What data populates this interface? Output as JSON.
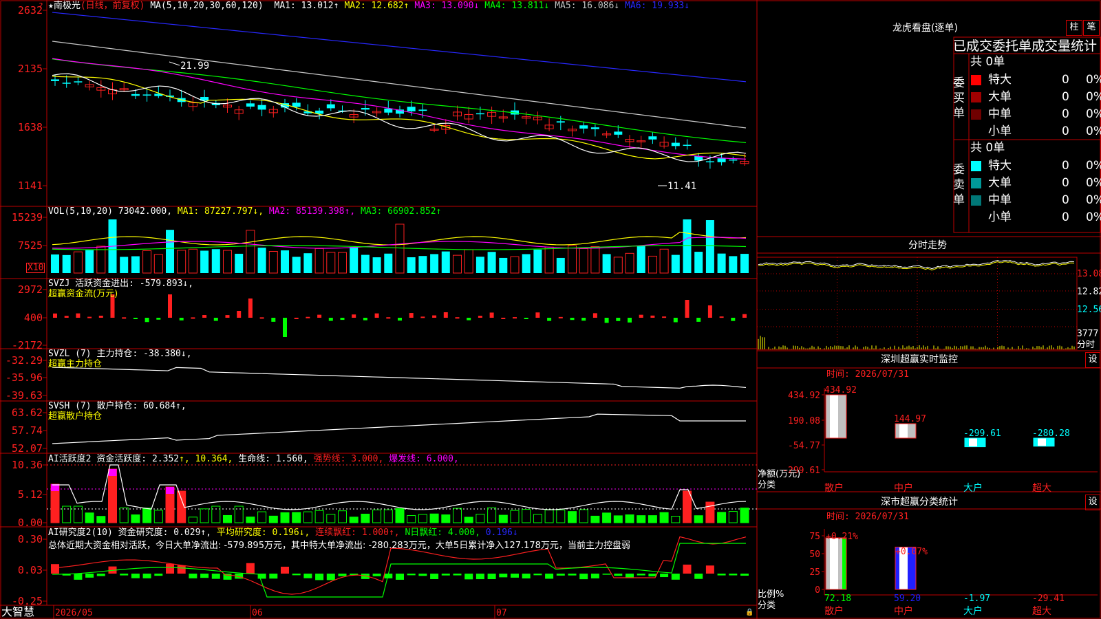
{
  "colors": {
    "up": "#ff2020",
    "down": "#00ffff",
    "grid": "#c00000",
    "yellow": "#ffff00",
    "magenta": "#ff00ff",
    "green": "#00ff00",
    "white": "#ffffff",
    "blue": "#2828ff",
    "gray": "#c0c0c0"
  },
  "main": {
    "title_star": "★",
    "stock_name": "南极光",
    "period": "(日线，前复权)",
    "ma_label": "MA(5,10,20,30,60,120)",
    "ma_values": [
      {
        "label": "MA1: 13.012",
        "arrow": "↑",
        "color": "#ffffff"
      },
      {
        "label": "MA2: 12.682",
        "arrow": "↑",
        "color": "#ffff00"
      },
      {
        "label": "MA3: 13.090",
        "arrow": "↓",
        "color": "#ff00ff"
      },
      {
        "label": "MA4: 13.811",
        "arrow": "↓",
        "color": "#00ff00"
      },
      {
        "label": "MA5: 16.086",
        "arrow": "↓",
        "color": "#c0c0c0"
      },
      {
        "label": "MA6: 19.933",
        "arrow": "↓",
        "color": "#2828ff"
      }
    ],
    "y_ticks": [
      "2632",
      "2135",
      "1638",
      "1141"
    ],
    "high_mark": "21.99",
    "low_mark": "11.41",
    "corner_mark": "?"
  },
  "volume": {
    "label": "VOL(5,10,20)",
    "value": "73042.000",
    "ma1": "MA1: 87227.797↓",
    "ma2": "MA2: 85139.398↑",
    "ma3": "MA3: 66902.852↑",
    "y_ticks": [
      "15239",
      "7525"
    ],
    "unit": "X10"
  },
  "svzj": {
    "label": "SVZJ  活跃资金进出: -579.893↓,",
    "sub": "超赢资金流(万元)",
    "y_ticks": [
      "2972",
      "400",
      "-2172"
    ]
  },
  "svzl": {
    "label": "SVZL (7) 主力持仓: -38.380↓,",
    "sub": "超赢主力持仓",
    "y_ticks": [
      "-32.29",
      "-35.96",
      "-39.63"
    ]
  },
  "svsh": {
    "label": "SVSH (7) 散户持仓: 60.684↑,",
    "sub": "超赢散户持仓",
    "y_ticks": [
      "63.62",
      "57.74",
      "52.07"
    ]
  },
  "ai1": {
    "label": "AI活跃度2 资金活跃度: 2.352",
    "v1": "↑, 10.364,",
    "v2": "生命线: 1.560,",
    "v3": "强势线: 3.000,",
    "v4": "爆发线: 6.000,",
    "y_ticks": [
      "10.36",
      "5.12",
      "0.00"
    ]
  },
  "ai2": {
    "label": "AI研究度2(10) 资金研究度: 0.029↑,",
    "v1": "平均研究度: 0.196↓,",
    "v2": "连续飘红: 1.000↑,",
    "v3": "N日飘红: 4.000,",
    "v4": "0.196↓",
    "summary": "总体近期大资金相对活跃，今日大单净流出: -579.895万元，其中特大单净流出: -280.283万元，大单5日累计净入127.178万元，当前主力控盘弱",
    "y_ticks": [
      "0.30",
      "0.03",
      "-0.25"
    ]
  },
  "timeline": {
    "app_name": "大智慧",
    "dates": [
      "2026/05",
      "06",
      "07"
    ]
  },
  "lhkp": {
    "title": "龙虎看盘(逐单)",
    "btn1": "柱",
    "btn2": "笔",
    "header": "已成交委托单成交量统计",
    "buy": {
      "group": "委买单",
      "total": "共 0单",
      "rows": [
        {
          "name": "特大",
          "vol": "0",
          "pct": "0%",
          "color": "#ff0000"
        },
        {
          "name": "大单",
          "vol": "0",
          "pct": "0%",
          "color": "#a00000"
        },
        {
          "name": "中单",
          "vol": "0",
          "pct": "0%",
          "color": "#700000"
        },
        {
          "name": "小单",
          "vol": "0",
          "pct": "0%",
          "color": ""
        }
      ]
    },
    "sell": {
      "group": "委卖单",
      "total": "共 0单",
      "rows": [
        {
          "name": "特大",
          "vol": "0",
          "pct": "0%",
          "color": "#00ffff"
        },
        {
          "name": "大单",
          "vol": "0",
          "pct": "0%",
          "color": "#009999"
        },
        {
          "name": "中单",
          "vol": "0",
          "pct": "0%",
          "color": "#007777"
        },
        {
          "name": "小单",
          "vol": "0",
          "pct": "0%",
          "color": ""
        }
      ]
    }
  },
  "intraday": {
    "title": "分时走势",
    "y_ticks": [
      "13.08",
      "12.82",
      "12.56"
    ],
    "vol_tick": "3777",
    "vol_unit": "分时"
  },
  "monitor": {
    "title": "深圳超赢实时监控",
    "btn": "设",
    "time": "时间: 2026/07/31",
    "y_ticks": [
      "434.92",
      "190.08",
      "-54.77",
      "-299.61"
    ],
    "axis_label1": "净额(万元)",
    "axis_label2": "分类",
    "categories": [
      "散户",
      "中户",
      "大户",
      "超大"
    ],
    "values": [
      434.92,
      144.97,
      -299.61,
      -280.28
    ],
    "value_labels": [
      "434.92",
      "144.97",
      "-299.61",
      "-280.28"
    ]
  },
  "classify": {
    "title": "深市超赢分类统计",
    "btn": "设",
    "time": "时间: 2026/07/31",
    "y_ticks": [
      "75",
      "50",
      "25",
      "0"
    ],
    "axis_label1": "比例%",
    "axis_label2": "分类",
    "categories": [
      "散户",
      "中户",
      "大户",
      "超大"
    ],
    "values": [
      72.18,
      59.2,
      -1.97,
      -29.41
    ],
    "value_labels": [
      "72.18",
      "59.20",
      "-1.97",
      "-29.41"
    ],
    "pct_labels": [
      "+0.21%",
      "+0.07%"
    ]
  }
}
